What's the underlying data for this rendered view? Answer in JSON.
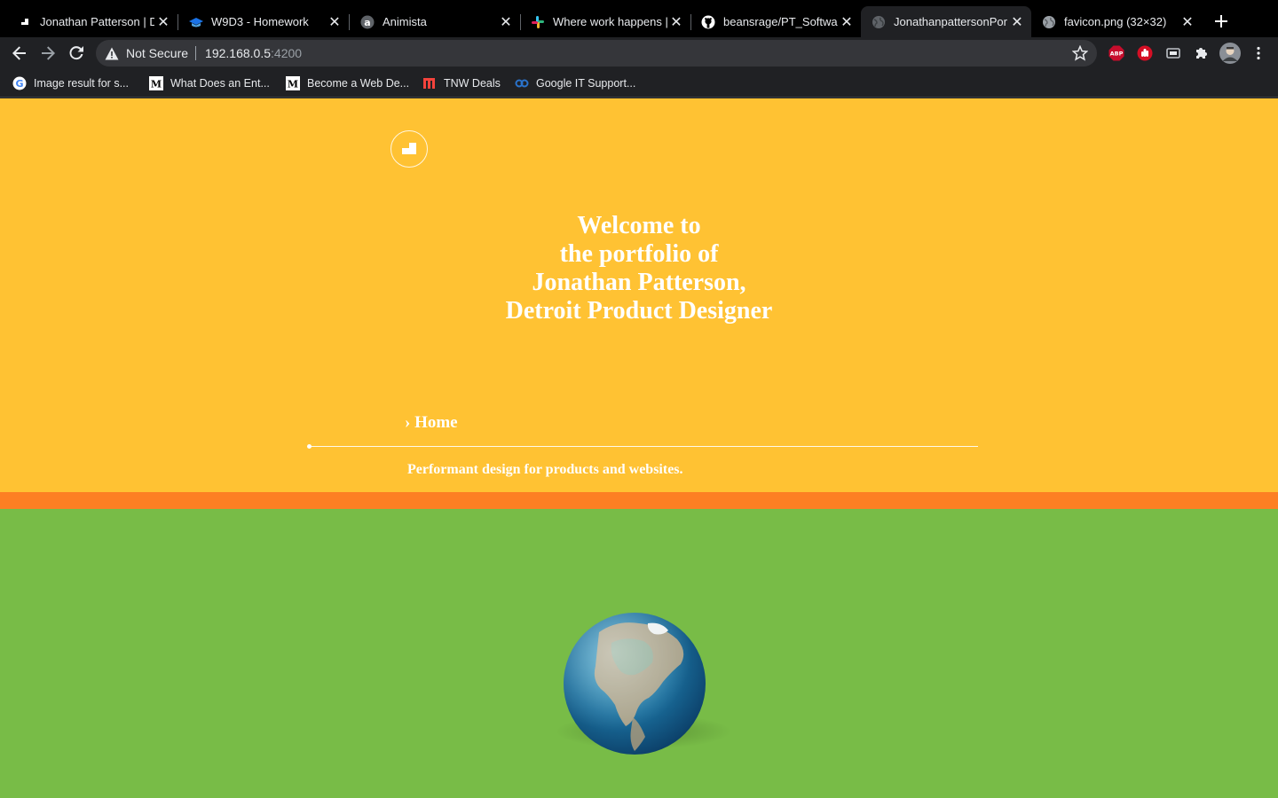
{
  "browser": {
    "tabs": [
      {
        "title": "Jonathan Patterson | D",
        "favicon": "jp-logo-icon",
        "active": false
      },
      {
        "title": "W9D3 - Homework",
        "favicon": "graduation-cap-icon",
        "active": false
      },
      {
        "title": "Animista",
        "favicon": "animista-icon",
        "active": false
      },
      {
        "title": "Where work happens |",
        "favicon": "slack-icon",
        "active": false
      },
      {
        "title": "beansrage/PT_Softwar",
        "favicon": "github-icon",
        "active": false
      },
      {
        "title": "JonathanpattersonPor",
        "favicon": "globe-icon",
        "active": true
      },
      {
        "title": "favicon.png (32×32)",
        "favicon": "globe-icon",
        "active": false
      }
    ],
    "address": {
      "security_label": "Not Secure",
      "host": "192.168.0.5",
      "port": ":4200"
    },
    "bookmarks": [
      {
        "label": "Image result for s...",
        "favicon": "google-icon"
      },
      {
        "label": "What Does an Ent...",
        "favicon": "medium-icon"
      },
      {
        "label": "Become a Web De...",
        "favicon": "medium-icon"
      },
      {
        "label": "TNW Deals",
        "favicon": "tnw-icon"
      },
      {
        "label": "Google IT Support...",
        "favicon": "coursera-icon"
      }
    ]
  },
  "page": {
    "headline": [
      "Welcome to",
      "the portfolio of",
      "Jonathan Patterson,",
      "Detroit Product Designer"
    ],
    "nav_home": "› Home",
    "tagline": "Performant design for products and websites.",
    "colors": {
      "hero": "#ffc233",
      "band": "#fd7f23",
      "section": "#78bc47"
    }
  }
}
